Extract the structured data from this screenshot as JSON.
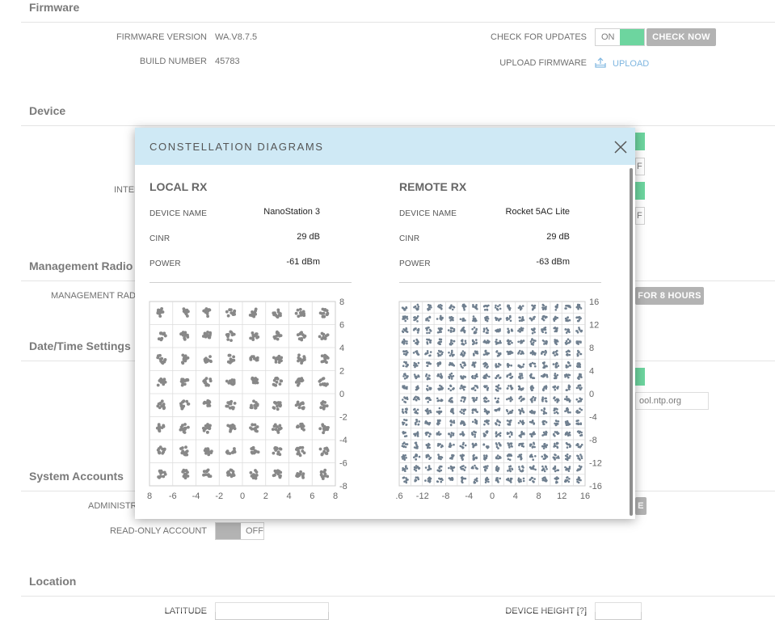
{
  "firmware": {
    "title": "Firmware",
    "version_label": "FIRMWARE VERSION",
    "version_value": "WA.V8.7.5",
    "build_label": "BUILD NUMBER",
    "build_value": "45783",
    "check_label": "CHECK FOR UPDATES",
    "check_toggle": "ON",
    "check_now": "CHECK NOW",
    "upload_label": "UPLOAD FIRMWARE",
    "upload_link": "UPLOAD"
  },
  "device": {
    "title": "Device",
    "partial_label": "INTER",
    "partial_off_1": "F",
    "partial_off_2": "F"
  },
  "management": {
    "title": "Management Radio S",
    "row_label": "MANAGEMENT RADI",
    "button": "FOR 8 HOURS"
  },
  "datetime": {
    "title": "Date/Time Settings",
    "ntp_value": "ool.ntp.org"
  },
  "accounts": {
    "title": "System Accounts",
    "admin_label": "ADMINISTR",
    "admin_btn": "E",
    "readonly_label": "READ-ONLY ACCOUNT",
    "readonly_toggle": "OFF"
  },
  "location": {
    "title": "Location",
    "latitude_label": "LATITUDE",
    "height_label": "DEVICE HEIGHT [?]"
  },
  "modal": {
    "title": "CONSTELLATION DIAGRAMS",
    "local": {
      "title": "LOCAL RX",
      "device_label": "DEVICE NAME",
      "device_value": "NanoStation 3",
      "cinr_label": "CINR",
      "cinr_value": "29 dB",
      "power_label": "POWER",
      "power_value": "-61 dBm"
    },
    "remote": {
      "title": "REMOTE RX",
      "device_label": "DEVICE NAME",
      "device_value": "Rocket 5AC Lite",
      "cinr_label": "CINR",
      "cinr_value": "29 dB",
      "power_label": "POWER",
      "power_value": "-63 dBm"
    }
  },
  "colors": {
    "accent_green": "#1fbf6c",
    "header_blue": "#cfe9f5",
    "link_blue": "#3a8fd0",
    "local_points": "#888888",
    "remote_points": "#6f7f8f"
  },
  "chart_data": [
    {
      "type": "scatter",
      "name": "local-constellation",
      "grid": 8,
      "xlim": [
        -8,
        8
      ],
      "ylim": [
        -8,
        8
      ],
      "x_ticks": [
        "8",
        "-6",
        "-4",
        "-2",
        "0",
        "2",
        "4",
        "6",
        "8"
      ],
      "y_ticks": [
        "8",
        "6",
        "4",
        "2",
        "0",
        "-2",
        "-4",
        "-6",
        "-8"
      ],
      "grid_lines": true
    },
    {
      "type": "scatter",
      "name": "remote-constellation",
      "grid": 16,
      "xlim": [
        -16,
        16
      ],
      "ylim": [
        -16,
        16
      ],
      "x_ticks": [
        ".6",
        "-12",
        "-8",
        "-4",
        "0",
        "4",
        "8",
        "12",
        "16"
      ],
      "y_ticks": [
        "16",
        "12",
        "8",
        "4",
        "0",
        "-4",
        "-8",
        "-12",
        "-16"
      ],
      "grid_lines": true
    }
  ]
}
